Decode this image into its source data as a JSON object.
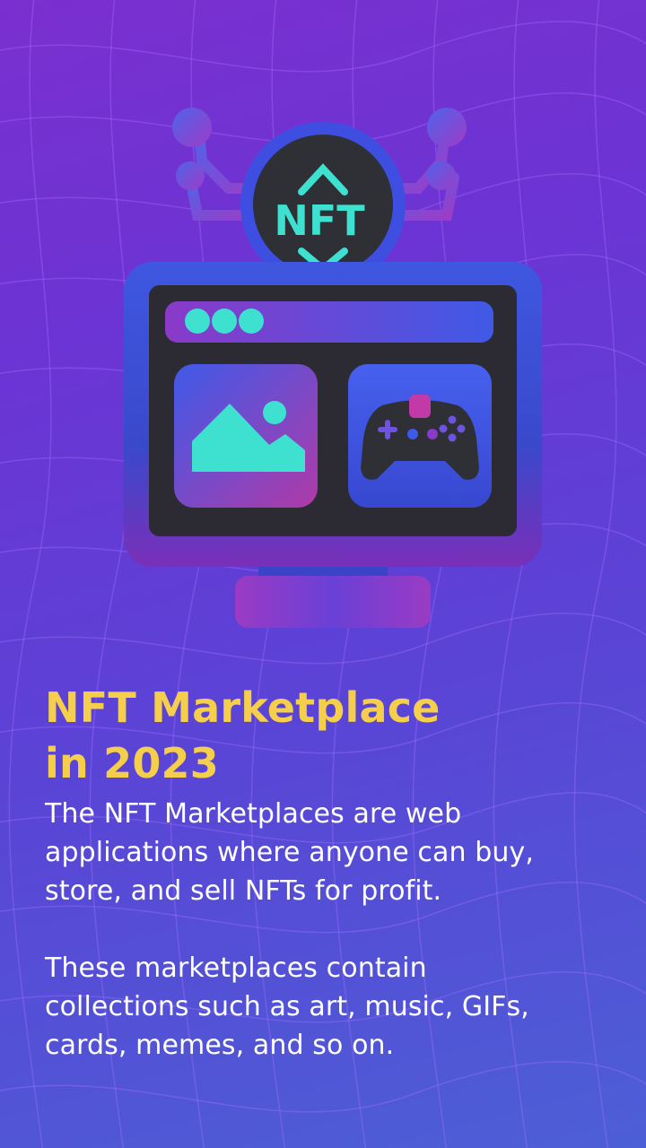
{
  "headline": {
    "line1": "NFT Marketplace",
    "line2": "in 2023"
  },
  "paragraph1": {
    "lines": [
      "The NFT Marketplaces are web",
      "applications where anyone can buy,",
      "store, and sell NFTs for profit."
    ]
  },
  "paragraph2": {
    "lines": [
      "These marketplaces contain",
      "collections such as art, music, GIFs,",
      "cards, memes, and so on."
    ]
  },
  "illustration": {
    "badge_text": "NFT",
    "icons": [
      "nft-badge-icon",
      "monitor-icon",
      "image-icon",
      "gamepad-icon",
      "circuit-icon"
    ]
  },
  "colors": {
    "headline": "#f5cf4b",
    "body_text": "#ffffff",
    "accent_teal": "#3ee0d0",
    "background_top": "#7a2fd0",
    "background_bottom": "#4c5fd6"
  }
}
